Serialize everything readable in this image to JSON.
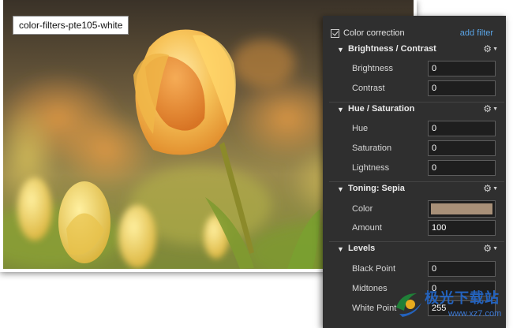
{
  "image": {
    "label": "color-filters-pte105-white"
  },
  "panel": {
    "master": {
      "label": "Color correction",
      "checked": true
    },
    "add_filter_label": "add filter",
    "sections": [
      {
        "title": "Brightness / Contrast",
        "rows": [
          {
            "label": "Brightness",
            "value": "0"
          },
          {
            "label": "Contrast",
            "value": "0"
          }
        ]
      },
      {
        "title": "Hue / Saturation",
        "rows": [
          {
            "label": "Hue",
            "value": "0"
          },
          {
            "label": "Saturation",
            "value": "0"
          },
          {
            "label": "Lightness",
            "value": "0"
          }
        ]
      },
      {
        "title": "Toning: Sepia",
        "rows": [
          {
            "label": "Color",
            "color": "#a89078"
          },
          {
            "label": "Amount",
            "value": "100"
          }
        ]
      },
      {
        "title": "Levels",
        "rows": [
          {
            "label": "Black Point",
            "value": "0"
          },
          {
            "label": "Midtones",
            "value": "0"
          },
          {
            "label": "White Point",
            "value": "255"
          }
        ]
      }
    ]
  },
  "icons": {
    "collapse": "chevron-down-icon",
    "settings": "gear-menu-icon",
    "check": "checkbox-checked-icon"
  },
  "watermark": {
    "name": "极光下载站",
    "url": "www.xz7.com"
  },
  "colors": {
    "panel_bg": "#2f2f2f",
    "link": "#5aa4e6",
    "field_bg": "#1e1e1e"
  }
}
